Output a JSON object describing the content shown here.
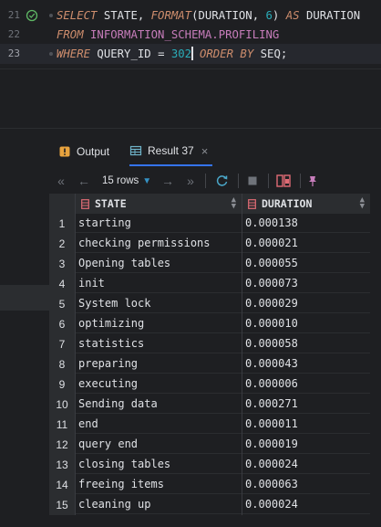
{
  "editor": {
    "lines": [
      {
        "num": "21",
        "has_check": true,
        "tokens": [
          {
            "t": "SELECT",
            "c": "kw"
          },
          {
            "t": " STATE, ",
            "c": "id"
          },
          {
            "t": "FORMAT",
            "c": "fn"
          },
          {
            "t": "(DURATION, ",
            "c": "id"
          },
          {
            "t": "6",
            "c": "num"
          },
          {
            "t": ") ",
            "c": "id"
          },
          {
            "t": "AS",
            "c": "kw"
          },
          {
            "t": " DURATION",
            "c": "id"
          }
        ]
      },
      {
        "num": "22",
        "has_check": false,
        "tokens": [
          {
            "t": "FROM",
            "c": "kw"
          },
          {
            "t": " INFORMATION_SCHEMA.PROFILING",
            "c": "schema"
          }
        ]
      },
      {
        "num": "23",
        "has_check": false,
        "tokens": [
          {
            "t": "WHERE",
            "c": "kw"
          },
          {
            "t": " QUERY_ID = ",
            "c": "id"
          },
          {
            "t": "302",
            "c": "num"
          },
          {
            "t": "|",
            "c": "caret"
          },
          {
            "t": " ",
            "c": "id"
          },
          {
            "t": "ORDER BY",
            "c": "kw"
          },
          {
            "t": " SEQ;",
            "c": "id"
          }
        ]
      }
    ]
  },
  "tabs": {
    "output_label": "Output",
    "result_label": "Result 37",
    "close_glyph": "×"
  },
  "toolbar": {
    "rows_label": "15 rows",
    "first": "«",
    "prev": "←",
    "next": "→",
    "last": "»"
  },
  "grid": {
    "columns": [
      "STATE",
      "DURATION"
    ],
    "rows": [
      {
        "n": "1",
        "state": "starting",
        "duration": "0.000138"
      },
      {
        "n": "2",
        "state": "checking permissions",
        "duration": "0.000021"
      },
      {
        "n": "3",
        "state": "Opening tables",
        "duration": "0.000055"
      },
      {
        "n": "4",
        "state": "init",
        "duration": "0.000073"
      },
      {
        "n": "5",
        "state": "System lock",
        "duration": "0.000029"
      },
      {
        "n": "6",
        "state": "optimizing",
        "duration": "0.000010"
      },
      {
        "n": "7",
        "state": "statistics",
        "duration": "0.000058"
      },
      {
        "n": "8",
        "state": "preparing",
        "duration": "0.000043"
      },
      {
        "n": "9",
        "state": "executing",
        "duration": "0.000006"
      },
      {
        "n": "10",
        "state": "Sending data",
        "duration": "0.000271"
      },
      {
        "n": "11",
        "state": "end",
        "duration": "0.000011"
      },
      {
        "n": "12",
        "state": "query end",
        "duration": "0.000019"
      },
      {
        "n": "13",
        "state": "closing tables",
        "duration": "0.000024"
      },
      {
        "n": "14",
        "state": "freeing items",
        "duration": "0.000063"
      },
      {
        "n": "15",
        "state": "cleaning up",
        "duration": "0.000024"
      }
    ]
  },
  "colors": {
    "accent": "#3574f0",
    "background": "#1e1f22",
    "keyword": "#cf8e6d",
    "number": "#2aacb8",
    "schema": "#c77dbb"
  }
}
